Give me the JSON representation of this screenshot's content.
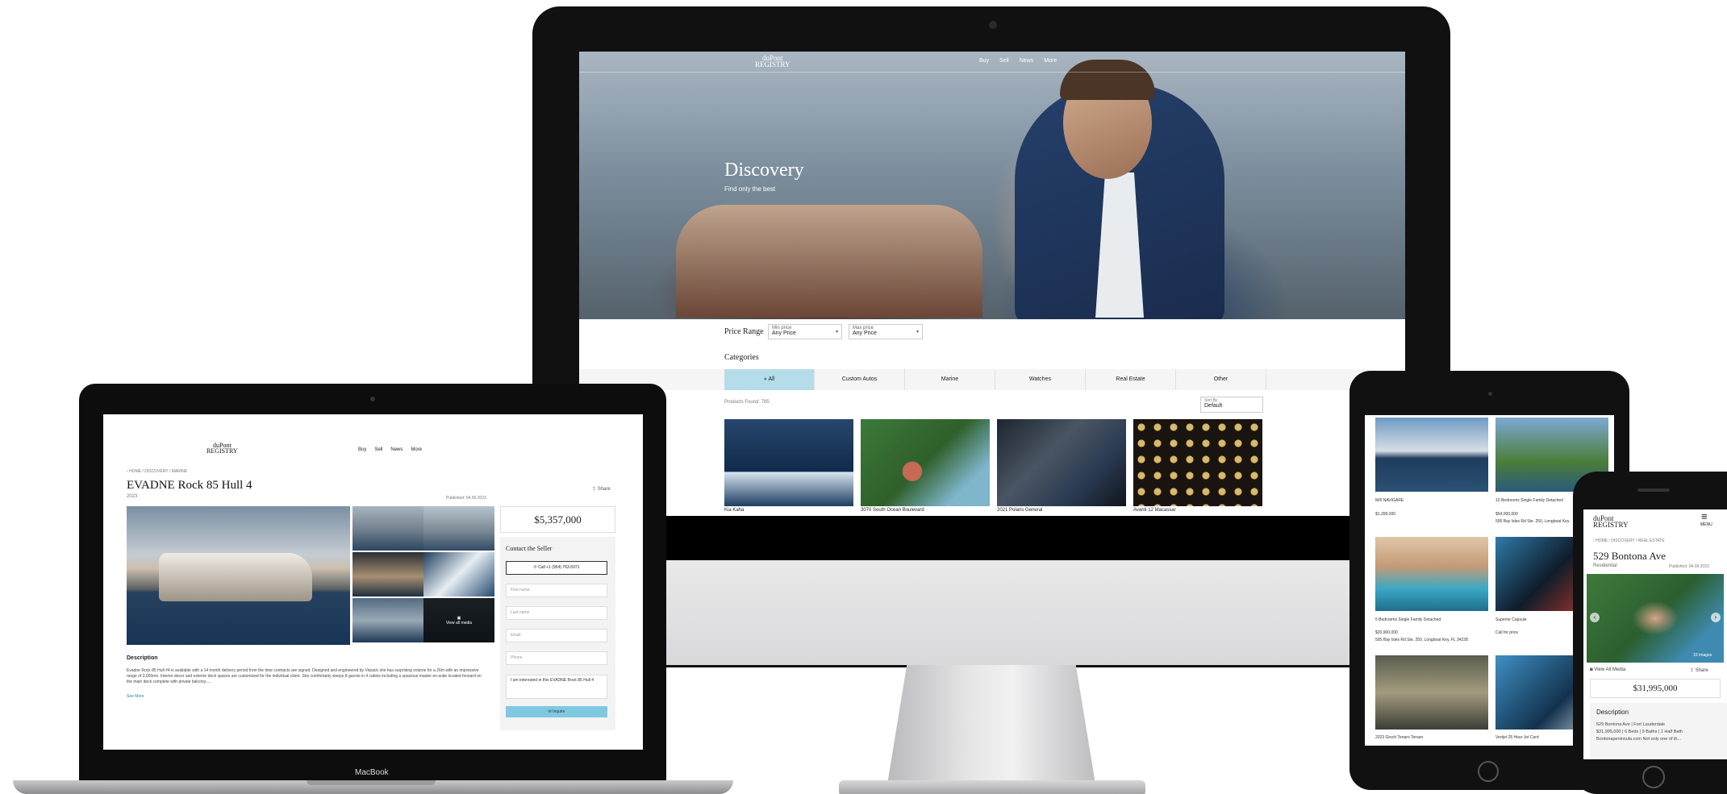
{
  "imac": {
    "logo_top": "duPont",
    "logo_bottom": "REGISTRY",
    "nav": [
      "Buy",
      "Sell",
      "News",
      "More"
    ],
    "hero_title": "Discovery",
    "hero_subtitle": "Find only the best",
    "price_range_label": "Price Range",
    "min_price": {
      "label": "Min price",
      "value": "Any Price"
    },
    "max_price": {
      "label": "Max price",
      "value": "Any Price"
    },
    "categories_label": "Categories",
    "categories": [
      "All",
      "Custom Autos",
      "Marine",
      "Watches",
      "Real Estate",
      "Other"
    ],
    "products_found": "Products Found: 785",
    "sort_by": {
      "label": "Sort By",
      "value": "Default"
    },
    "listings": [
      "Kia Kaha",
      "3070 South Ocean Boulevard",
      "2021 Polaris General",
      "Avanti 12 Macassar"
    ]
  },
  "macbook": {
    "label": "MacBook",
    "logo_top": "duPont",
    "logo_bottom": "REGISTRY",
    "nav": [
      "Buy",
      "Sell",
      "News",
      "More"
    ],
    "breadcrumb": "HOME / DISCOVERY / MARINE",
    "title": "EVADNE Rock 85 Hull 4",
    "year": "2023",
    "published": "Published: 04.05.2023",
    "share": "Share",
    "view_all": "View all media",
    "price": "$5,357,000",
    "contact_title": "Contact the Seller",
    "call": "Call +1 (954) 763-5971",
    "fields": [
      "First name",
      "Last name",
      "Email",
      "Phone"
    ],
    "message": "I am interested in this EVADNE Rock 85 Hull 4",
    "inquire": "Inquire",
    "description_heading": "Description",
    "description": "Evadne Rock 85 Hull #4 is available with a 14 month delivery period from the time contracts are signed. Designed and engineered by Vripack she has surprising volume for a 26m with an impressive range of 3,000nm. Interior decor and exterior deck spaces are customized for the individual client. She comfortably sleeps 8 guests in 4 cabins including a spacious master en-suite located forward on the main deck complete with private balcony.....",
    "see_more": "See More"
  },
  "ipad": {
    "listings": [
      {
        "name": "M/6 NAVIGARE",
        "price": "$1,399,000",
        "address": ""
      },
      {
        "name": "10 Bedrooms Single Family Detached",
        "price": "$54,000,000",
        "address": "595 Bay Isles Rd Ste. 250, Longboat Key"
      },
      {
        "name": "5 Bedrooms Single Family Detached",
        "price": "$20,900,000",
        "address": "595 Bay Isles Rd Ste. 250, Longboat Key, FL 34228"
      },
      {
        "name": "Superior Capsule",
        "price": "Call for price",
        "address": ""
      },
      {
        "name": "2023 Grech Tenaro Tenaro",
        "price": "",
        "address": ""
      },
      {
        "name": "Vertjet 25 Hour Jet Card",
        "price": "",
        "address": ""
      }
    ]
  },
  "iphone": {
    "logo_top": "duPont",
    "logo_bottom": "REGISTRY",
    "menu": "MENU",
    "breadcrumb": "HOME / DISCOVERY / REAL ESTATE",
    "title": "529 Bontona Ave",
    "subtitle": "Residential",
    "published": "Published: 04.09.2023",
    "images_count": "10 Images",
    "view_all": "View All Media",
    "share": "Share",
    "price": "$31,995,000",
    "description_heading": "Description",
    "description_lines": [
      "529 Bontona Ave | Fort Lauderdale",
      "$31,995,000 | 6 Beds | 9 Baths | 1 Half Bath",
      "Bontonapeninsula.com Not only one of th..."
    ]
  }
}
